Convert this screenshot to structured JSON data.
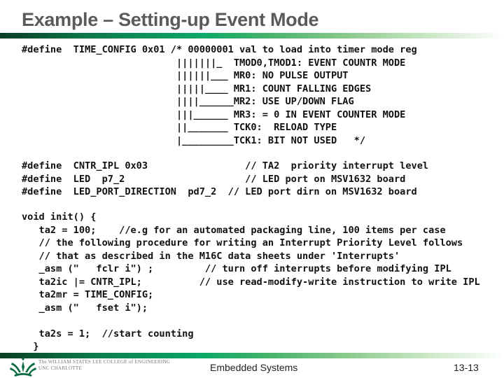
{
  "slide": {
    "title": "Example – Setting-up Event Mode",
    "footer": {
      "center": "Embedded Systems",
      "page": "13-13",
      "college_line1": "The WILLIAM STATES LEE COLLEGE of ENGINEERING",
      "college_line2": "UNC CHARLOTTE"
    },
    "colors": {
      "title": "#5a5a5a",
      "bar_dark": "#0a3d24",
      "bar_mid": "#0aa866",
      "bar_light": "#cbe8c6"
    }
  },
  "code": {
    "define_block": [
      "#define  TIME_CONFIG 0x01 /* 00000001 val to load into timer mode reg",
      "                           |||||||_  TMOD0,TMOD1: EVENT COUNTR MODE",
      "                           ||||||___ MR0: NO PULSE OUTPUT",
      "                           |||||____ MR1: COUNT FALLING EDGES",
      "                           ||||______MR2: USE UP/DOWN FLAG",
      "                           |||______ MR3: = 0 IN EVENT COUNTER MODE",
      "                           ||_______ TCK0:  RELOAD TYPE",
      "                           |_________TCK1: BIT NOT USED   */"
    ],
    "defines": [
      "#define  CNTR_IPL 0x03                 // TA2  priority interrupt level",
      "#define  LED  p7_2                     // LED port on MSV1632 board",
      "#define  LED_PORT_DIRECTION  pd7_2  // LED port dirn on MSV1632 board"
    ],
    "function": [
      "void init() {",
      "   ta2 = 100;    //e.g for an automated packaging line, 100 items per case",
      "   // the following procedure for writing an Interrupt Priority Level follows",
      "   // that as described in the M16C data sheets under 'Interrupts'",
      "   _asm (\"   fclr i\") ;         // turn off interrupts before modifying IPL",
      "   ta2ic |= CNTR_IPL;          // use read-modify-write instruction to write IPL",
      "   ta2mr = TIME_CONFIG;",
      "   _asm (\"   fset i\");",
      "",
      "   ta2s = 1;  //start counting",
      "  }"
    ]
  }
}
